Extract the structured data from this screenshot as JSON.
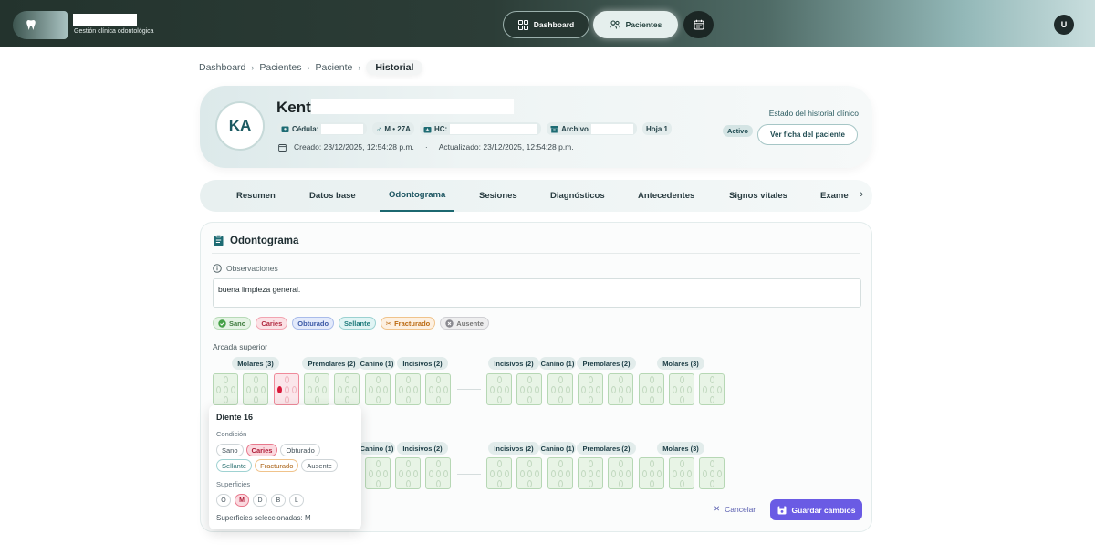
{
  "brand": {
    "subtitle": "Gestión clínica odontológica"
  },
  "nav": {
    "dashboard": "Dashboard",
    "patients": "Pacientes",
    "user_initial": "U"
  },
  "breadcrumb": [
    "Dashboard",
    "Pacientes",
    "Paciente",
    "Historial"
  ],
  "patient": {
    "initials": "KA",
    "name": "Kent",
    "cedula_label": "Cédula:",
    "sex_age": "M • 27A",
    "hc_label": "HC:",
    "archivo_label": "Archivo",
    "hoja": "Hoja 1",
    "created": "Creado: 23/12/2025, 12:54:28 p.m.",
    "updated": "Actualizado: 23/12/2025, 12:54:28 p.m.",
    "status_label": "Estado del historial clínico",
    "status": "Activo",
    "view_button": "Ver ficha del paciente"
  },
  "tabs": [
    "Resumen",
    "Datos base",
    "Odontograma",
    "Sesiones",
    "Diagnósticos",
    "Antecedentes",
    "Signos vitales",
    "Exame"
  ],
  "active_tab": "Odontograma",
  "odontogram": {
    "title": "Odontograma",
    "observations_label": "Observaciones",
    "observations": "buena limpieza general.",
    "legend": [
      "Sano",
      "Caries",
      "Obturado",
      "Sellante",
      "Fracturado",
      "Ausente"
    ],
    "upper_label": "Arcada superior",
    "upper_groups_left": [
      "Molares (3)",
      "Premolares (2)",
      "Canino (1)",
      "Incisivos (2)"
    ],
    "upper_groups_right": [
      "Incisivos (2)",
      "Canino (1)",
      "Premolares (2)",
      "Molares (3)"
    ],
    "lower_groups_left": [
      "Canino (1)",
      "Incisivos (2)"
    ],
    "lower_groups_right": [
      "Incisivos (2)",
      "Canino (1)",
      "Premolares (2)",
      "Molares (3)"
    ],
    "selected_tooth_index": 2,
    "colors": {
      "healthy": "#e8f4e6",
      "caries": "#d81b3b",
      "primary": "#6a5be4"
    }
  },
  "popup": {
    "title": "Diente 16",
    "condition_label": "Condición",
    "conditions": [
      "Sano",
      "Caries",
      "Obturado",
      "Sellante",
      "Fracturado",
      "Ausente"
    ],
    "selected_condition": "Caries",
    "surfaces_label": "Superficies",
    "surfaces": [
      "O",
      "M",
      "D",
      "B",
      "L"
    ],
    "selected_surface": "M",
    "footer": "Superficies seleccionadas: M"
  },
  "actions": {
    "cancel": "Cancelar",
    "save": "Guardar cambios"
  }
}
